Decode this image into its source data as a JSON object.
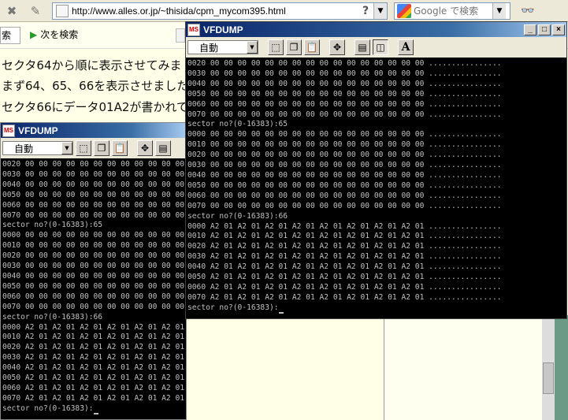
{
  "browser": {
    "url": "http://www.alles.or.jp/~thisida/cpm_mycom395.html",
    "help_button": "?",
    "search_placeholder": "Google で検索",
    "partial_input": "索",
    "next_search_label": "次を検索"
  },
  "article": {
    "line1": "セクタ64から順に表示させてみま",
    "line2": "まず64、65、66を表示させました",
    "line3": "セクタ66にデータ01A2が書かれて"
  },
  "window_back": {
    "title": "VFDUMP",
    "font_value": "自動",
    "console_lines": [
      "0020 00 00 00 00 00 00 00 00 00 00 00 00",
      "0030 00 00 00 00 00 00 00 00 00 00 00 00",
      "0040 00 00 00 00 00 00 00 00 00 00 00 00",
      "0050 00 00 00 00 00 00 00 00 00 00 00 00",
      "0060 00 00 00 00 00 00 00 00 00 00 00 00",
      "0070 00 00 00 00 00 00 00 00 00 00 00 00",
      "sector no?(0-16383):65",
      "0000 00 00 00 00 00 00 00 00 00 00 00 00",
      "0010 00 00 00 00 00 00 00 00 00 00 00 00",
      "0020 00 00 00 00 00 00 00 00 00 00 00 00",
      "0030 00 00 00 00 00 00 00 00 00 00 00 00",
      "0040 00 00 00 00 00 00 00 00 00 00 00 00",
      "0050 00 00 00 00 00 00 00 00 00 00 00 00",
      "0060 00 00 00 00 00 00 00 00 00 00 00 00",
      "0070 00 00 00 00 00 00 00 00 00 00 00 00",
      "sector no?(0-16383):66",
      "0000 A2 01 A2 01 A2 01 A2 01 A2 01 A2 01 A2 01 A2 01 ................",
      "0010 A2 01 A2 01 A2 01 A2 01 A2 01 A2 01 A2 01 A2 01 ................",
      "0020 A2 01 A2 01 A2 01 A2 01 A2 01 A2 01 A2 01 A2 01 ................",
      "0030 A2 01 A2 01 A2 01 A2 01 A2 01 A2 01 A2 01 A2 01 ................",
      "0040 A2 01 A2 01 A2 01 A2 01 A2 01 A2 01 A2 01 A2 01 ................",
      "0050 A2 01 A2 01 A2 01 A2 01 A2 01 A2 01 A2 01 A2 01 ................",
      "0060 A2 01 A2 01 A2 01 A2 01 A2 01 A2 01 A2 01 A2 01 ................",
      "0070 A2 01 A2 01 A2 01 A2 01 A2 01 A2 01 A2 01 A2 01 ................",
      "sector no?(0-16383):"
    ]
  },
  "window_front": {
    "title": "VFDUMP",
    "font_value": "自動",
    "console_lines": [
      "0020 00 00 00 00 00 00 00 00 00 00 00 00 00 00 00 00 ................",
      "0030 00 00 00 00 00 00 00 00 00 00 00 00 00 00 00 00 ................",
      "0040 00 00 00 00 00 00 00 00 00 00 00 00 00 00 00 00 ................",
      "0050 00 00 00 00 00 00 00 00 00 00 00 00 00 00 00 00 ................",
      "0060 00 00 00 00 00 00 00 00 00 00 00 00 00 00 00 00 ................",
      "0070 00 00 00 00 00 00 00 00 00 00 00 00 00 00 00 00 ................",
      "sector no?(0-16383):65",
      "0000 00 00 00 00 00 00 00 00 00 00 00 00 00 00 00 00 ................",
      "0010 00 00 00 00 00 00 00 00 00 00 00 00 00 00 00 00 ................",
      "0020 00 00 00 00 00 00 00 00 00 00 00 00 00 00 00 00 ................",
      "0030 00 00 00 00 00 00 00 00 00 00 00 00 00 00 00 00 ................",
      "0040 00 00 00 00 00 00 00 00 00 00 00 00 00 00 00 00 ................",
      "0050 00 00 00 00 00 00 00 00 00 00 00 00 00 00 00 00 ................",
      "0060 00 00 00 00 00 00 00 00 00 00 00 00 00 00 00 00 ................",
      "0070 00 00 00 00 00 00 00 00 00 00 00 00 00 00 00 00 ................",
      "sector no?(0-16383):66",
      "0000 A2 01 A2 01 A2 01 A2 01 A2 01 A2 01 A2 01 A2 01 ................",
      "0010 A2 01 A2 01 A2 01 A2 01 A2 01 A2 01 A2 01 A2 01 ................",
      "0020 A2 01 A2 01 A2 01 A2 01 A2 01 A2 01 A2 01 A2 01 ................",
      "0030 A2 01 A2 01 A2 01 A2 01 A2 01 A2 01 A2 01 A2 01 ................",
      "0040 A2 01 A2 01 A2 01 A2 01 A2 01 A2 01 A2 01 A2 01 ................",
      "0050 A2 01 A2 01 A2 01 A2 01 A2 01 A2 01 A2 01 A2 01 ................",
      "0060 A2 01 A2 01 A2 01 A2 01 A2 01 A2 01 A2 01 A2 01 ................",
      "0070 A2 01 A2 01 A2 01 A2 01 A2 01 A2 01 A2 01 A2 01 ................",
      "sector no?(0-16383):"
    ]
  },
  "icons": {
    "app_icon_text": "MS",
    "text_a_button": "A",
    "minimize": "_",
    "maximize": "□",
    "close": "×"
  }
}
